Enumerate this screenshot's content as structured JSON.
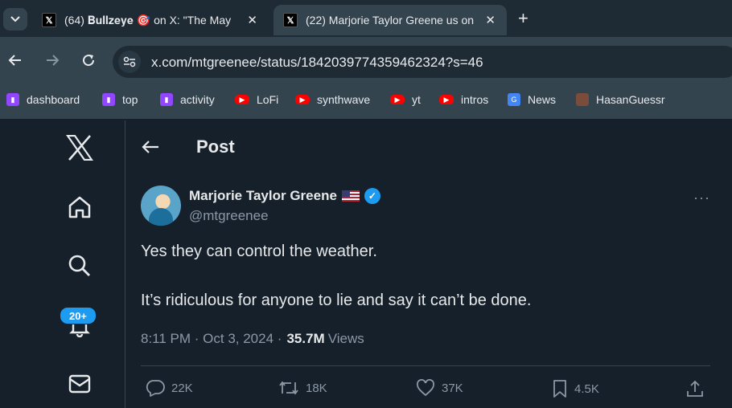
{
  "browser": {
    "tabs": [
      {
        "title": "(64) 𝐁𝐮𝐥𝐥𝐳𝐞𝐲𝐞 🎯 on X: \"The May",
        "active": false
      },
      {
        "title": "(22) Marjorie Taylor Greene us on",
        "active": true
      }
    ],
    "url": "x.com/mtgreenee/status/1842039774359462324?s=46",
    "bookmarks": [
      {
        "label": "dashboard",
        "icon": "twitch-icon"
      },
      {
        "label": "top",
        "icon": "twitch-icon"
      },
      {
        "label": "activity",
        "icon": "twitch-icon"
      },
      {
        "label": "LoFi",
        "icon": "youtube-icon"
      },
      {
        "label": "synthwave",
        "icon": "youtube-icon"
      },
      {
        "label": "yt",
        "icon": "youtube-icon"
      },
      {
        "label": "intros",
        "icon": "youtube-icon"
      },
      {
        "label": "News",
        "icon": "google-news-icon"
      },
      {
        "label": "HasanGuessr",
        "icon": "hasanguessr-icon"
      }
    ]
  },
  "sidebar": {
    "notifications_badge": "20+"
  },
  "header": {
    "title": "Post"
  },
  "post": {
    "author_name": "Marjorie Taylor Greene",
    "handle": "@mtgreenee",
    "text_line1": "Yes they can control the weather.",
    "text_line2": "It’s ridiculous for anyone to lie and say it can’t be done.",
    "timestamp": "8:11 PM · Oct 3, 2024 ·",
    "views_count": "35.7M",
    "views_label": "Views",
    "replies": "22K",
    "reposts": "18K",
    "likes": "37K",
    "bookmarks": "4.5K"
  },
  "colors": {
    "background": "#15202b",
    "accent": "#1d9bf0",
    "text": "#e7e9ea",
    "secondary_text": "#8b98a5"
  }
}
